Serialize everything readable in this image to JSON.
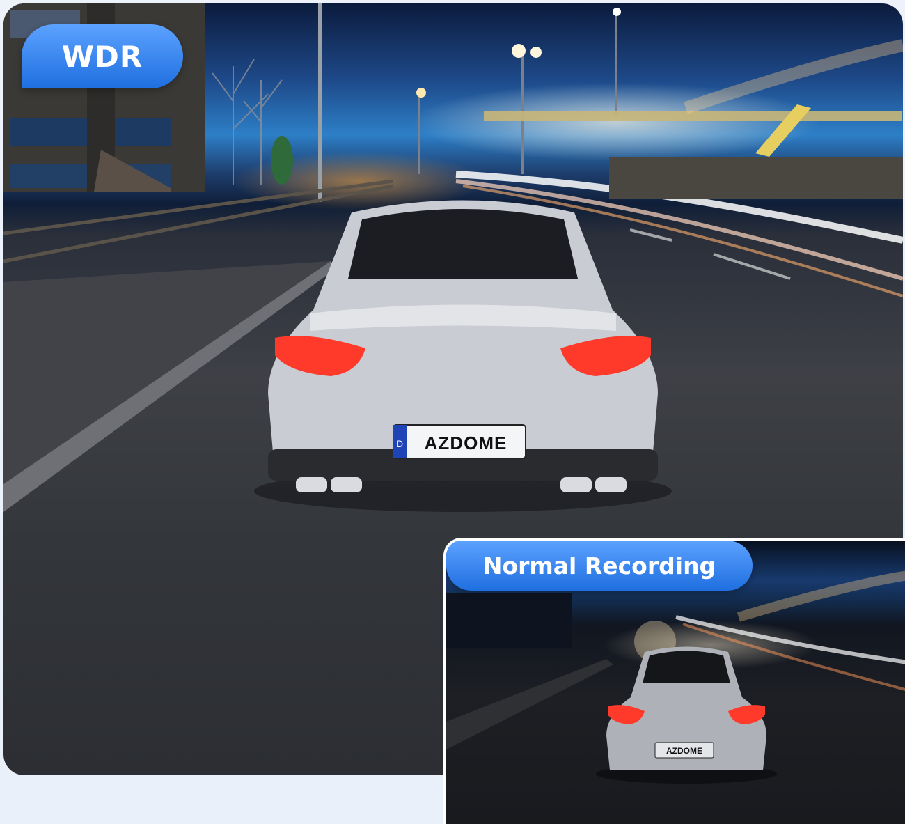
{
  "badges": {
    "main": "WDR",
    "inset": "Normal Recording"
  },
  "plate": {
    "main": "AZDOME",
    "inset": "AZDOME",
    "country": "D"
  },
  "colors": {
    "badge_top": "#5ca2ff",
    "badge_bottom": "#1f6fe0",
    "taillight": "#ff3a2a",
    "car_body": "#c9ccd2"
  }
}
